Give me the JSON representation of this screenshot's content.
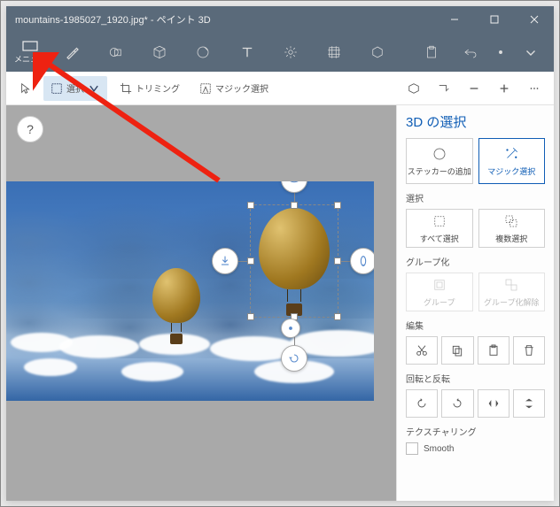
{
  "titlebar": {
    "title": "mountains-1985027_1920.jpg* - ペイント 3D"
  },
  "toptoolbar": {
    "menu": "メニュー"
  },
  "subtoolbar": {
    "select": "選択",
    "trimming": "トリミング",
    "magic_select": "マジック選択"
  },
  "help": "?",
  "side": {
    "title": "3D の選択",
    "add_sticker": "ステッカーの追加",
    "magic_select": "マジック選択",
    "section_select": "選択",
    "select_all": "すべて選択",
    "multi_select": "複数選択",
    "section_group": "グループ化",
    "group": "グループ",
    "ungroup": "グループ化解除",
    "section_edit": "編集",
    "section_rotate": "回転と反転",
    "section_texture": "テクスチャリング",
    "smooth": "Smooth"
  }
}
